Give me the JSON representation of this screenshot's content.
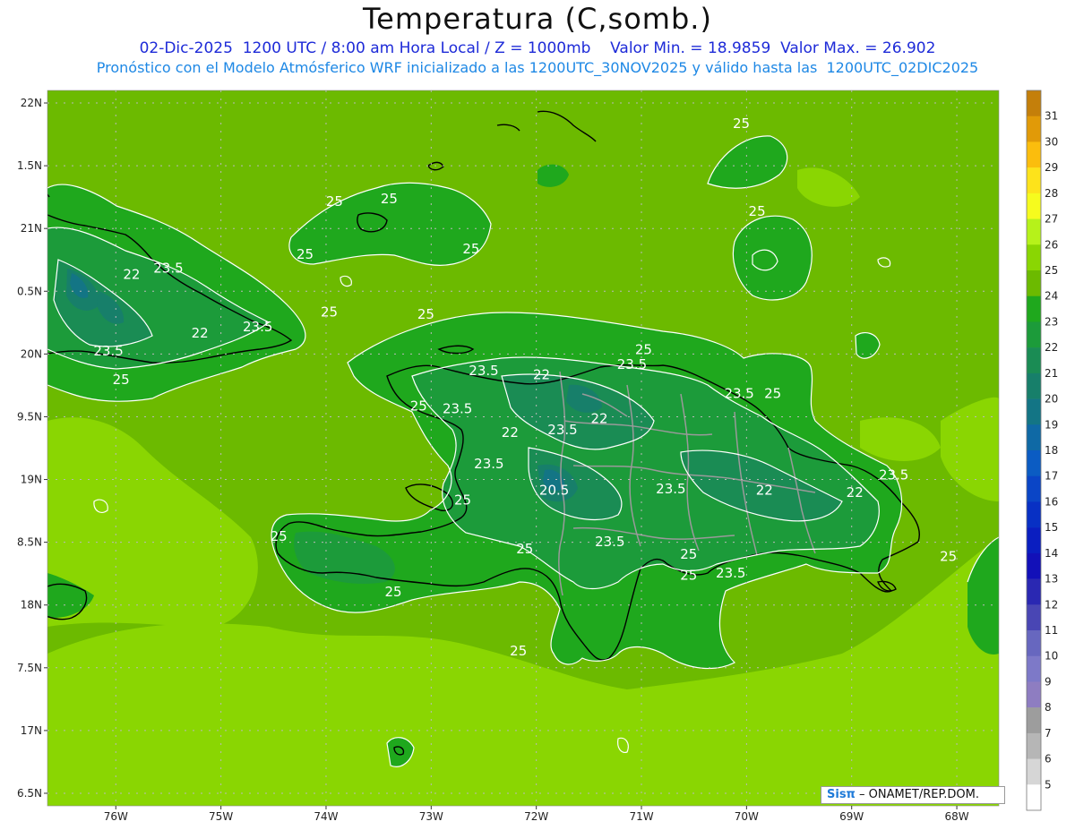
{
  "header": {
    "title": "Temperatura (C,somb.)",
    "line1": "02-Dic-2025  1200 UTC / 8:00 am Hora Local / Z = 1000mb    Valor Min. = 18.9859  Valor Max. = 26.902",
    "line2": "Pronóstico con el Modelo Atmósferico WRF inicializado a las 1200UTC_30NOV2025 y válido hasta las  1200UTC_02DIC2025"
  },
  "credit": {
    "logo": "Sisπ",
    "text": " – ONAMET/REP.DOM."
  },
  "map": {
    "lon_range": [
      -76.65,
      -67.6
    ],
    "lat_range": [
      16.4,
      22.1
    ],
    "lon_ticks": [
      {
        "value": -76,
        "label": "76W"
      },
      {
        "value": -75,
        "label": "75W"
      },
      {
        "value": -74,
        "label": "74W"
      },
      {
        "value": -73,
        "label": "73W"
      },
      {
        "value": -72,
        "label": "72W"
      },
      {
        "value": -71,
        "label": "71W"
      },
      {
        "value": -70,
        "label": "70W"
      },
      {
        "value": -69,
        "label": "69W"
      },
      {
        "value": -68,
        "label": "68W"
      }
    ],
    "lat_ticks": [
      {
        "value": 22,
        "label": "22N"
      },
      {
        "value": 21.5,
        "label": "1.5N"
      },
      {
        "value": 21,
        "label": "21N"
      },
      {
        "value": 20.5,
        "label": "0.5N"
      },
      {
        "value": 20,
        "label": "20N"
      },
      {
        "value": 19.5,
        "label": "9.5N"
      },
      {
        "value": 19,
        "label": "19N"
      },
      {
        "value": 18.5,
        "label": "8.5N"
      },
      {
        "value": 18,
        "label": "18N"
      },
      {
        "value": 17.5,
        "label": "7.5N"
      },
      {
        "value": 17,
        "label": "17N"
      },
      {
        "value": 16.5,
        "label": "6.5N"
      }
    ],
    "contour_labels": [
      {
        "text": "25",
        "lon": -75.95,
        "lat": 19.76
      },
      {
        "text": "23.5",
        "lon": -76.07,
        "lat": 19.99
      },
      {
        "text": "22",
        "lon": -75.2,
        "lat": 20.13
      },
      {
        "text": "23.5",
        "lon": -75.5,
        "lat": 20.65
      },
      {
        "text": "22",
        "lon": -75.85,
        "lat": 20.6
      },
      {
        "text": "23.5",
        "lon": -74.65,
        "lat": 20.18
      },
      {
        "text": "25",
        "lon": -73.97,
        "lat": 20.3
      },
      {
        "text": "25",
        "lon": -73.92,
        "lat": 21.18
      },
      {
        "text": "25",
        "lon": -73.4,
        "lat": 21.2
      },
      {
        "text": "25",
        "lon": -74.2,
        "lat": 20.76
      },
      {
        "text": "25",
        "lon": -72.62,
        "lat": 20.8
      },
      {
        "text": "25",
        "lon": -70.05,
        "lat": 21.8
      },
      {
        "text": "25",
        "lon": -69.9,
        "lat": 21.1
      },
      {
        "text": "25",
        "lon": -73.05,
        "lat": 20.28
      },
      {
        "text": "23.5",
        "lon": -72.5,
        "lat": 19.83
      },
      {
        "text": "22",
        "lon": -71.95,
        "lat": 19.8
      },
      {
        "text": "23.5",
        "lon": -71.09,
        "lat": 19.88
      },
      {
        "text": "25",
        "lon": -70.98,
        "lat": 20.0
      },
      {
        "text": "23.5",
        "lon": -70.07,
        "lat": 19.65
      },
      {
        "text": "25",
        "lon": -69.75,
        "lat": 19.65
      },
      {
        "text": "25",
        "lon": -73.12,
        "lat": 19.55
      },
      {
        "text": "23.5",
        "lon": -72.75,
        "lat": 19.53
      },
      {
        "text": "22",
        "lon": -71.4,
        "lat": 19.45
      },
      {
        "text": "23.5",
        "lon": -71.75,
        "lat": 19.36
      },
      {
        "text": "22",
        "lon": -72.25,
        "lat": 19.34
      },
      {
        "text": "23.5",
        "lon": -72.45,
        "lat": 19.09
      },
      {
        "text": "20.5",
        "lon": -71.83,
        "lat": 18.88
      },
      {
        "text": "23.5",
        "lon": -70.72,
        "lat": 18.89
      },
      {
        "text": "22",
        "lon": -69.83,
        "lat": 18.88
      },
      {
        "text": "22",
        "lon": -68.97,
        "lat": 18.86
      },
      {
        "text": "23.5",
        "lon": -68.6,
        "lat": 19.0
      },
      {
        "text": "25",
        "lon": -72.7,
        "lat": 18.8
      },
      {
        "text": "25",
        "lon": -74.45,
        "lat": 18.51
      },
      {
        "text": "25",
        "lon": -72.11,
        "lat": 18.41
      },
      {
        "text": "23.5",
        "lon": -71.3,
        "lat": 18.47
      },
      {
        "text": "25",
        "lon": -70.55,
        "lat": 18.37
      },
      {
        "text": "25",
        "lon": -70.55,
        "lat": 18.2
      },
      {
        "text": "23.5",
        "lon": -70.15,
        "lat": 18.22
      },
      {
        "text": "25",
        "lon": -68.08,
        "lat": 18.35
      },
      {
        "text": "25",
        "lon": -73.36,
        "lat": 18.07
      },
      {
        "text": "25",
        "lon": -72.17,
        "lat": 17.6
      }
    ],
    "colorbar": [
      {
        "label": "31",
        "color": "#c47f0a"
      },
      {
        "label": "30",
        "color": "#e19a08"
      },
      {
        "label": "29",
        "color": "#fbbd0d"
      },
      {
        "label": "28",
        "color": "#fde31b"
      },
      {
        "label": "27",
        "color": "#f6fb1e"
      },
      {
        "label": "26",
        "color": "#b6f21a"
      },
      {
        "label": "25",
        "color": "#8ad602"
      },
      {
        "label": "24",
        "color": "#6cba00"
      },
      {
        "label": "23",
        "color": "#1fa81d"
      },
      {
        "label": "22",
        "color": "#1c9b3a"
      },
      {
        "label": "21",
        "color": "#1a8c54"
      },
      {
        "label": "20",
        "color": "#177f6a"
      },
      {
        "label": "19",
        "color": "#137585"
      },
      {
        "label": "18",
        "color": "#0f69a5"
      },
      {
        "label": "17",
        "color": "#0b5cc3"
      },
      {
        "label": "16",
        "color": "#0a45c6"
      },
      {
        "label": "15",
        "color": "#0830c4"
      },
      {
        "label": "14",
        "color": "#0a1ec0"
      },
      {
        "label": "13",
        "color": "#1210b8"
      },
      {
        "label": "12",
        "color": "#2a28b2"
      },
      {
        "label": "11",
        "color": "#4946b4"
      },
      {
        "label": "10",
        "color": "#6767bf"
      },
      {
        "label": "9",
        "color": "#7d79c8"
      },
      {
        "label": "8",
        "color": "#8e7dc1"
      },
      {
        "label": "7",
        "color": "#9d9d9d"
      },
      {
        "label": "6",
        "color": "#b6b6b6"
      },
      {
        "label": "5",
        "color": "#d6d6d6"
      },
      {
        "label": "",
        "color": "#ffffff"
      }
    ]
  }
}
